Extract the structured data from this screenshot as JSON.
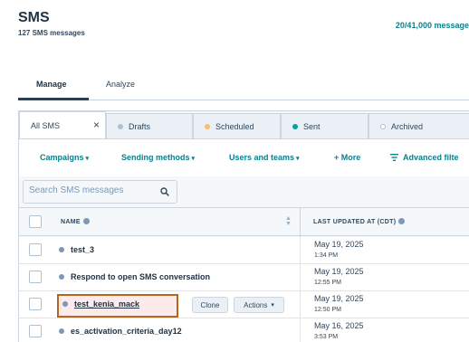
{
  "header": {
    "title": "SMS",
    "subtitle": "127 SMS messages",
    "quota": "20/41,000 message"
  },
  "page_tabs": [
    {
      "label": "Manage",
      "active": true
    },
    {
      "label": "Analyze",
      "active": false
    }
  ],
  "view_tabs": [
    {
      "label": "All SMS",
      "active": true,
      "dot_color": null
    },
    {
      "label": "Drafts",
      "dot_color": "#b0c1d4"
    },
    {
      "label": "Scheduled",
      "dot_color": "#f5c26b"
    },
    {
      "label": "Sent",
      "dot_color": "#00a4a6"
    },
    {
      "label": "Archived",
      "dot_color": "#ffffff"
    }
  ],
  "filters": {
    "campaigns": "Campaigns",
    "sending_methods": "Sending methods",
    "users_and_teams": "Users and teams",
    "more": "+ More",
    "advanced_filters": "Advanced filte"
  },
  "search": {
    "placeholder": "Search SMS messages"
  },
  "table": {
    "columns": [
      "NAME",
      "LAST UPDATED AT (CDT)"
    ],
    "rows": [
      {
        "name": "test_3",
        "date": "May 19, 2025",
        "time": "1:34 PM"
      },
      {
        "name": "Respond to open SMS conversation",
        "date": "May 19, 2025",
        "time": "12:55 PM"
      },
      {
        "name": "test_kenia_mack",
        "date": "May 19, 2025",
        "time": "12:50 PM",
        "highlighted": true
      },
      {
        "name": "es_activation_criteria_day12",
        "date": "May 16, 2025",
        "time": "3:53 PM"
      }
    ],
    "row_actions": {
      "clone": "Clone",
      "actions": "Actions"
    }
  },
  "colors": {
    "accent": "#0a7f8e",
    "highlight_border": "#b5651d"
  }
}
